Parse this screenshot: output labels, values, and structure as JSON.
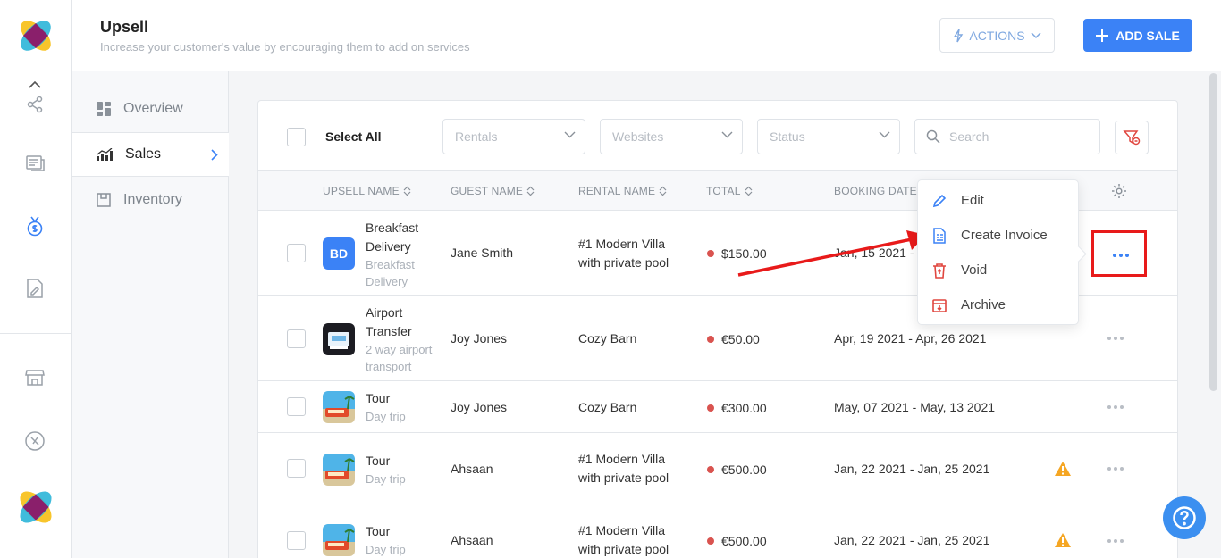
{
  "header": {
    "title": "Upsell",
    "subtitle": "Increase your customer's value by encouraging them to add on services",
    "actions_label": "ACTIONS",
    "add_sale_label": "ADD SALE"
  },
  "subnav": {
    "items": [
      {
        "label": "Overview"
      },
      {
        "label": "Sales"
      },
      {
        "label": "Inventory"
      }
    ]
  },
  "toolbar": {
    "select_all_label": "Select All",
    "rentals_placeholder": "Rentals",
    "websites_placeholder": "Websites",
    "status_placeholder": "Status",
    "search_placeholder": "Search"
  },
  "table": {
    "columns": [
      "UPSELL NAME",
      "GUEST NAME",
      "RENTAL NAME",
      "TOTAL",
      "BOOKING DATES"
    ],
    "rows": [
      {
        "thumb": "BD",
        "name": "Breakfast Delivery",
        "desc": "Breakfast Delivery",
        "guest": "Jane Smith",
        "rental": "#1 Modern Villa with private pool",
        "total": "$150.00",
        "dates": "Jan, 15 2021 - ",
        "warning": false
      },
      {
        "thumb": "airport-image",
        "name": "Airport Transfer",
        "desc": "2 way airport transport",
        "guest": "Joy Jones",
        "rental": "Cozy Barn",
        "total": "€50.00",
        "dates": "Apr, 19 2021 - Apr, 26 2021",
        "warning": false
      },
      {
        "thumb": "tour-image",
        "name": "Tour",
        "desc": "Day trip",
        "guest": "Joy Jones",
        "rental": "Cozy Barn",
        "total": "€300.00",
        "dates": "May, 07 2021 - May, 13 2021",
        "warning": false
      },
      {
        "thumb": "tour-image",
        "name": "Tour",
        "desc": "Day trip",
        "guest": "Ahsaan",
        "rental": "#1 Modern Villa with private pool",
        "total": "€500.00",
        "dates": "Jan, 22 2021 - Jan, 25 2021",
        "warning": true
      },
      {
        "thumb": "tour-image",
        "name": "Tour",
        "desc": "Day trip",
        "guest": "Ahsaan",
        "rental": "#1 Modern Villa with private pool",
        "total": "€500.00",
        "dates": "Jan, 22 2021 - Jan, 25 2021",
        "warning": true
      }
    ]
  },
  "menu": {
    "items": [
      {
        "label": "Edit",
        "icon": "pencil-icon"
      },
      {
        "label": "Create Invoice",
        "icon": "invoice-icon"
      },
      {
        "label": "Void",
        "icon": "trash-icon"
      },
      {
        "label": "Archive",
        "icon": "archive-icon"
      }
    ]
  },
  "colors": {
    "primary": "#3b82f6",
    "status_dot": "#d9534f",
    "warning": "#f5a623",
    "highlight": "#e81a1a"
  }
}
